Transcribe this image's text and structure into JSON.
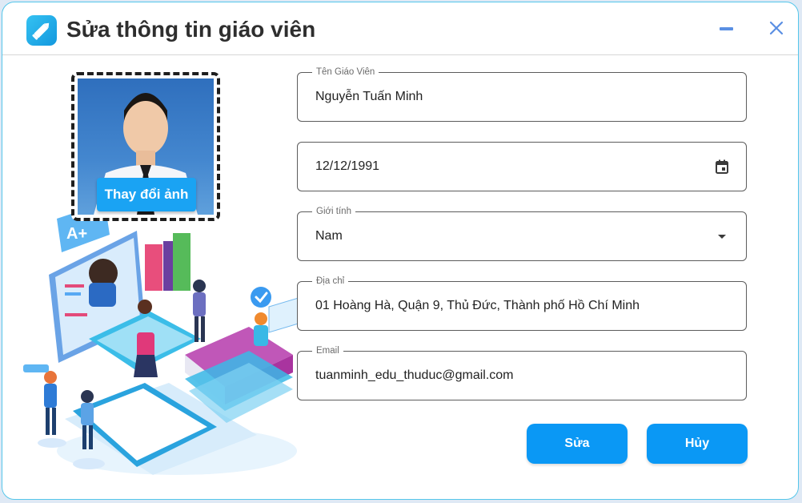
{
  "window": {
    "title": "Sửa thông tin giáo viên"
  },
  "photo": {
    "change_label": "Thay đổi ảnh"
  },
  "form": {
    "name": {
      "label": "Tên Giáo Viên",
      "value": "Nguyễn Tuấn Minh"
    },
    "birthdate": {
      "value": "12/12/1991"
    },
    "gender": {
      "label": "Giới tính",
      "value": "Nam"
    },
    "address": {
      "label": "Địa chỉ",
      "value": "01 Hoàng Hà, Quận 9, Thủ Đức, Thành phố Hồ Chí Minh"
    },
    "email": {
      "label": "Email",
      "value": "tuanminh_edu_thuduc@gmail.com"
    }
  },
  "actions": {
    "save_label": "Sửa",
    "cancel_label": "Hủy"
  },
  "illustration": {
    "grade_text": "A+"
  },
  "icons": [
    "pencil-icon",
    "minimize-icon",
    "close-icon",
    "calendar-icon",
    "dropdown-arrow-icon",
    "checkmark-icon"
  ],
  "colors": {
    "accent": "#0a98f5",
    "title_text": "#2e2e2e",
    "window_controls": "#5a8fe3",
    "border": "#55c6ea"
  }
}
